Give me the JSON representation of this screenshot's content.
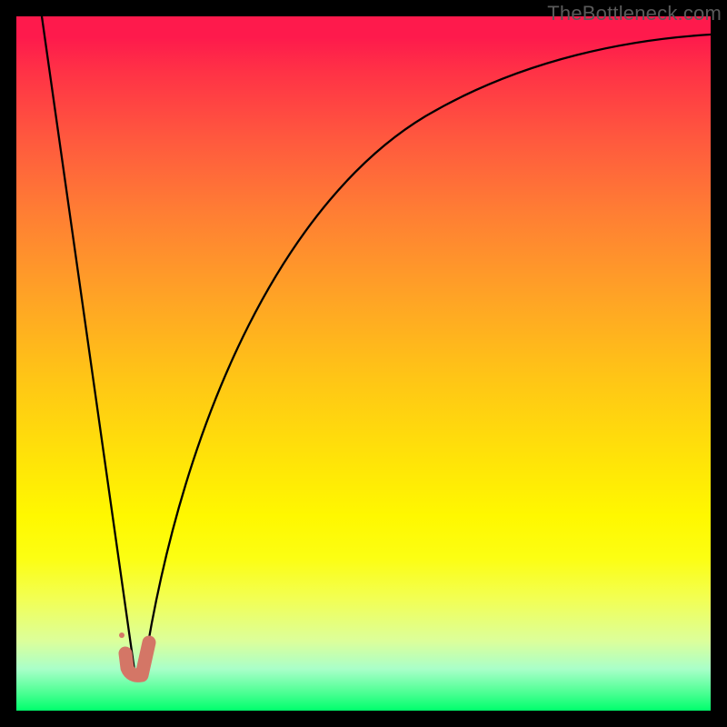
{
  "watermark": {
    "text": "TheBottleneck.com"
  },
  "chart_data": {
    "type": "line",
    "title": "",
    "xlabel": "",
    "ylabel": "",
    "xlim": [
      0,
      100
    ],
    "ylim": [
      0,
      100
    ],
    "grid": false,
    "legend": false,
    "series": [
      {
        "name": "bottleneck-curve",
        "x": [
          3,
          5,
          7,
          9,
          11,
          13,
          14.5,
          16,
          18,
          20,
          24,
          28,
          32,
          38,
          45,
          55,
          70,
          85,
          100
        ],
        "y": [
          100,
          86,
          72,
          58,
          44,
          30,
          16,
          2,
          2,
          16,
          36,
          50,
          60,
          70,
          78,
          84,
          90,
          93,
          95
        ]
      }
    ],
    "annotations": [
      {
        "name": "highlight-J",
        "approx_x": 16,
        "approx_y": 6,
        "color": "#d47666"
      }
    ],
    "gradient_stops": [
      {
        "pos": 0.0,
        "color": "#fe1a4c"
      },
      {
        "pos": 0.5,
        "color": "#ffcc00"
      },
      {
        "pos": 0.85,
        "color": "#f2ff55"
      },
      {
        "pos": 1.0,
        "color": "#00ff6c"
      }
    ]
  }
}
